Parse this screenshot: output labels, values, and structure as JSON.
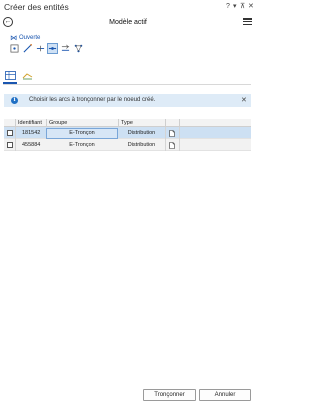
{
  "window": {
    "pane_title": "Créer des entités",
    "controls": [
      "?",
      "▾",
      "⊼",
      "✕"
    ]
  },
  "header": {
    "title": "Modèle actif"
  },
  "topology": {
    "label": "Ouverte"
  },
  "infobar": {
    "message": "Choisir les arcs à tronçonner par le noeud créé."
  },
  "grid": {
    "columns": [
      "Identifiant",
      "Groupe",
      "Type"
    ],
    "rows": [
      {
        "id": "181542",
        "group": "E-Tronçon",
        "type": "Distribution",
        "checked": false,
        "selected": true
      },
      {
        "id": "455884",
        "group": "E-Tronçon",
        "type": "Distribution",
        "checked": false,
        "selected": false
      }
    ]
  },
  "buttons": {
    "split": "Tronçonner",
    "cancel": "Annuler"
  },
  "colors": {
    "accent": "#1a56b0",
    "selected_row": "#cde0f3",
    "info_bg": "#deebf7"
  }
}
